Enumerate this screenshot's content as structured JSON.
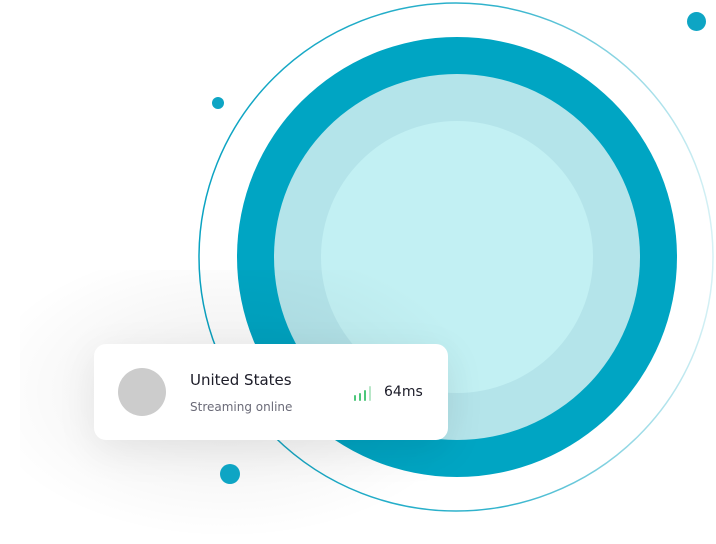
{
  "colors": {
    "accent": "#00a5c3",
    "ring_mid": "#b4e4ea",
    "ring_inner": "#c2f0f3",
    "dot": "#0ea5c4",
    "signal": "#4cc77a",
    "avatar_placeholder": "#cccccc"
  },
  "server_card": {
    "country": "United States",
    "status": "Streaming online",
    "latency": "64ms",
    "signal_icon": "signal-strength-icon",
    "signal_bars_active": 3,
    "signal_bars_total": 4,
    "avatar_icon": "flag-avatar-placeholder"
  }
}
